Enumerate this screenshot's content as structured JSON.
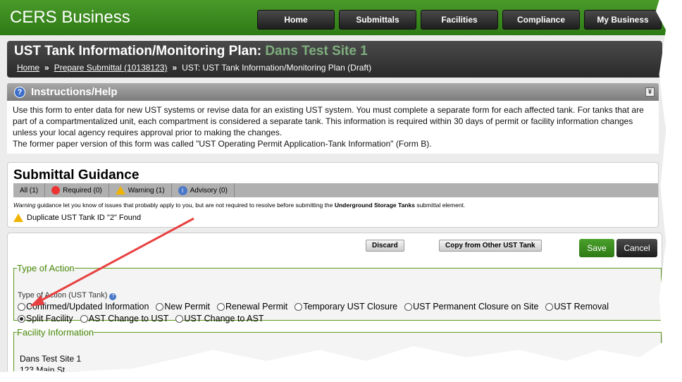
{
  "header": {
    "logo": "CERS Business",
    "nav": [
      "Home",
      "Submittals",
      "Facilities",
      "Compliance",
      "My Business"
    ]
  },
  "title": {
    "prefix": "UST Tank Information/Monitoring Plan:",
    "site": "Dans Test Site 1"
  },
  "breadcrumb": {
    "home": "Home",
    "sep": "»",
    "prepare": "Prepare Submittal (10138123)",
    "current": "UST: UST Tank Information/Monitoring Plan (Draft)"
  },
  "instructions": {
    "title": "Instructions/Help",
    "body": "Use this form to enter data for new UST systems or revise data for an existing UST system. You must complete a separate form for each affected tank. For tanks that are part of a compartmentalized unit, each compartment is considered a separate tank. This information is required within 30 days of permit or facility information changes unless your local agency requires approval prior to making the changes.",
    "body2": "The former paper version of this form was called \"UST Operating Permit Application-Tank Information\" (Form B)."
  },
  "guidance": {
    "title": "Submittal Guidance",
    "tabs": [
      "All (1)",
      "Required (0)",
      "Warning (1)",
      "Advisory (0)"
    ],
    "note_italic": "Warning",
    "note_a": " guidance let you know of issues that probably apply to you, but are not required to resolve before submitting the ",
    "note_bold": "Underground Storage Tanks",
    "note_b": " submittal element.",
    "item": "Duplicate UST Tank ID \"2\" Found"
  },
  "form": {
    "discard": "Discard",
    "copy": "Copy from Other UST Tank",
    "save": "Save",
    "cancel": "Cancel",
    "toa_legend": "Type of Action",
    "toa_label": "Type of Action (UST Tank)",
    "options": [
      "Confirmed/Updated Information",
      "New Permit",
      "Renewal Permit",
      "Temporary UST Closure",
      "UST Permanent Closure on Site",
      "UST Removal",
      "Split Facility",
      "AST Change to UST",
      "UST Change to AST"
    ],
    "selected": "Split Facility",
    "fi_legend": "Facility Information",
    "fi_name": "Dans Test Site 1",
    "fi_addr": "123 Main St"
  },
  "colors": {
    "brand_green": "#2e7a16",
    "annotation_arrow": "#e84040"
  }
}
